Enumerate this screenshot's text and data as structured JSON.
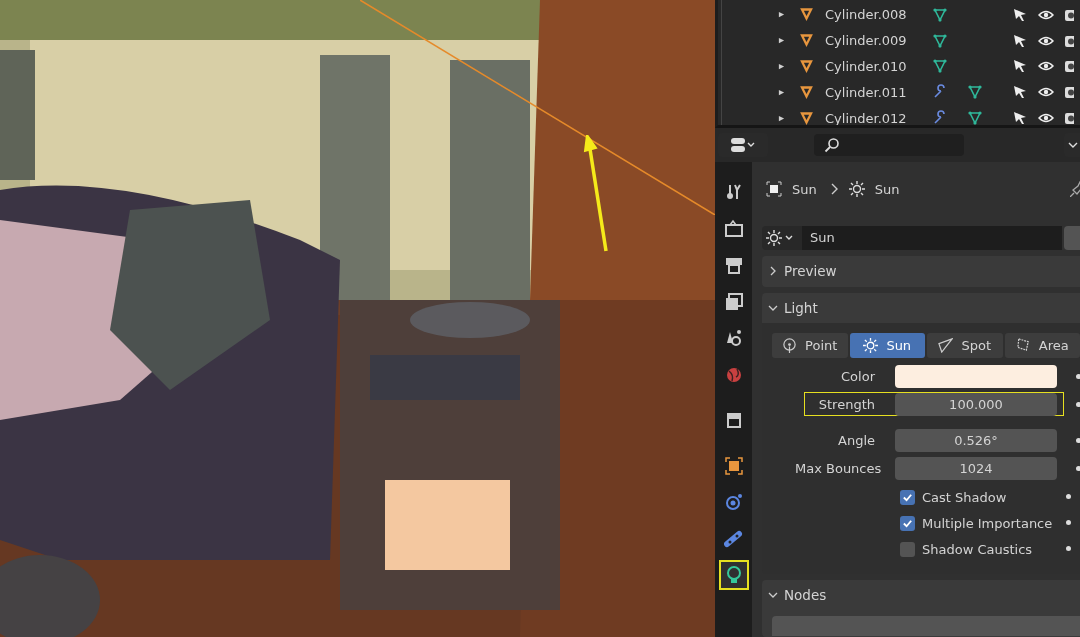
{
  "outliner": {
    "rows": [
      {
        "name": "Cylinder.008",
        "modifier": false
      },
      {
        "name": "Cylinder.009",
        "modifier": false
      },
      {
        "name": "Cylinder.010",
        "modifier": false
      },
      {
        "name": "Cylinder.011",
        "modifier": true
      },
      {
        "name": "Cylinder.012",
        "modifier": true
      }
    ]
  },
  "properties": {
    "breadcrumb": {
      "object": "Sun",
      "data": "Sun"
    },
    "datablock": "Sun",
    "tabs": [
      {
        "kind": "tool",
        "selected": false
      },
      {
        "kind": "render",
        "selected": false
      },
      {
        "kind": "output",
        "selected": false
      },
      {
        "kind": "view_layer",
        "selected": false
      },
      {
        "kind": "scene",
        "selected": false
      },
      {
        "kind": "world",
        "selected": false
      },
      {
        "kind": "collection",
        "selected": false
      },
      {
        "kind": "object",
        "selected": false
      },
      {
        "kind": "physics",
        "selected": false
      },
      {
        "kind": "constraints",
        "selected": false
      },
      {
        "kind": "light",
        "selected": true,
        "highlighted": true
      }
    ],
    "preview": {
      "title": "Preview",
      "expanded": false
    },
    "light": {
      "title": "Light",
      "expanded": true,
      "types": [
        {
          "kind": "point",
          "label": "Point",
          "selected": false
        },
        {
          "kind": "sun",
          "label": "Sun",
          "selected": true
        },
        {
          "kind": "spot",
          "label": "Spot",
          "selected": false
        },
        {
          "kind": "area",
          "label": "Area",
          "selected": false
        }
      ],
      "fields": [
        {
          "kind": "color",
          "label": "Color",
          "color": "#fdeee0",
          "highlighted": false
        },
        {
          "kind": "number",
          "label": "Strength",
          "value": "100.000",
          "highlighted": true
        },
        {
          "kind": "number",
          "label": "Angle",
          "value": "0.526°",
          "highlighted": false
        },
        {
          "kind": "number",
          "label": "Max Bounces",
          "value": "1024",
          "highlighted": false
        }
      ],
      "checks": [
        {
          "label": "Cast Shadow",
          "checked": true
        },
        {
          "label": "Multiple Importance",
          "checked": true
        },
        {
          "label": "Shadow Caustics",
          "checked": false
        }
      ]
    },
    "nodes": {
      "title": "Nodes",
      "expanded": true
    }
  }
}
